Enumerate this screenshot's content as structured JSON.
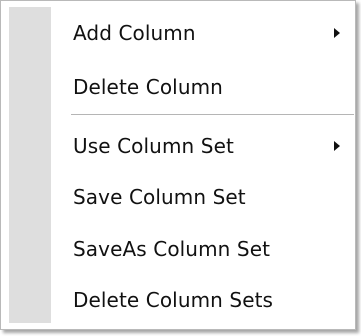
{
  "menu": {
    "items": [
      {
        "label": "Add Column",
        "has_submenu": true,
        "icon": "chevron-right-icon"
      },
      {
        "label": "Delete Column",
        "has_submenu": false
      },
      {
        "label": "Use Column Set",
        "has_submenu": true,
        "icon": "chevron-right-icon"
      },
      {
        "label": "Save Column Set",
        "has_submenu": false
      },
      {
        "label": "SaveAs Column Set",
        "has_submenu": false
      },
      {
        "label": "Delete Column Sets",
        "has_submenu": false
      }
    ]
  },
  "colors": {
    "background": "#ffffff",
    "gutter": "#dedede",
    "border": "#b9b9b9",
    "text": "#111111",
    "separator": "#b5b5b5"
  }
}
